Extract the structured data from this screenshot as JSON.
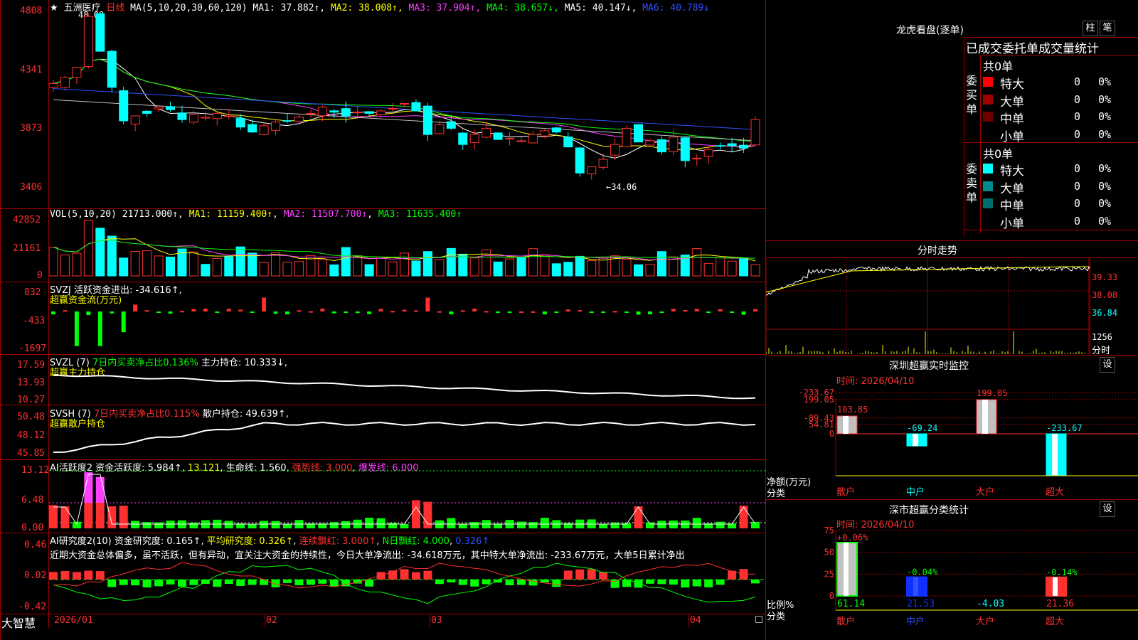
{
  "stock": {
    "star": "★",
    "name": "五洲医疗",
    "period": "日线",
    "ma_def": "MA(5,10,20,30,60,120)"
  },
  "ma_row": [
    {
      "t": "MA1: 37.882↑",
      "c": "#ffffff"
    },
    {
      "t": "MA2: 38.008↑",
      "c": "#ffff00"
    },
    {
      "t": "MA3: 37.904↑",
      "c": "#ff40ff"
    },
    {
      "t": "MA4: 38.657↓",
      "c": "#00ff00"
    },
    {
      "t": "MA5: 40.147↓",
      "c": "#ffffff"
    },
    {
      "t": "MA6: 40.789↓",
      "c": "#3050ff"
    }
  ],
  "price_axis": [
    "4808",
    "4341",
    "3873",
    "3406"
  ],
  "price_high": "48.08",
  "price_low": "←34.06",
  "vol": {
    "def": "VOL(5,10,20)",
    "val": "21713.000↑",
    "ma1": "MA1: 11159.400↑",
    "ma2": "MA2: 11507.700↑",
    "ma3": "MA3: 11635.400↑",
    "axis": [
      "42852",
      "21161",
      "0"
    ]
  },
  "svzj": {
    "title": "SVZJ  活跃资金进出: -34.616↑,",
    "sub": "超赢资金流(万元)",
    "axis": [
      "832",
      "-433",
      "-1697"
    ]
  },
  "svzl": {
    "title": "SVZL (7)",
    "p1": "7日内买卖净占比0.136%",
    "p2": "主力持仓: 10.333↓,",
    "sub": "超赢主力持仓",
    "axis": [
      "17.59",
      "13.93",
      "10.27"
    ]
  },
  "svsh": {
    "title": "SVSH (7)",
    "p1": "7日内买卖净占比0.115%",
    "p2": "散户持仓: 49.639↑,",
    "sub": "超赢散户持仓",
    "axis": [
      "50.48",
      "48.12",
      "45.85"
    ]
  },
  "ai1": {
    "title": "AI活跃度2",
    "p1": "资金活跃度: 5.984↑",
    "p2": "13.121",
    "p3": "生命线: 1.560",
    "p4": "强势线: 3.000",
    "p5": "爆发线: 6.000",
    "axis": [
      "13.12",
      "6.48",
      "0.00"
    ]
  },
  "ai2": {
    "title": "AI研究度2(10)",
    "p1": "资金研究度: 0.165↑",
    "p2": "平均研究度: 0.326↑",
    "p3": "连续飘红: 3.000↑",
    "p4": "N日飘红: 4.000",
    "p5": "0.326↑",
    "axis": [
      "0.46",
      "0.02",
      "-0.42"
    ],
    "comment": "近期大资金总体偏多，虽不活跃，但有异动，宜关注大资金的持续性，今日大单净流出: -34.618万元，其中特大单净流出: -233.67万元，大单5日累计净出"
  },
  "date_axis": [
    "2026/01",
    "02",
    "03",
    "04"
  ],
  "brand": "大智慧",
  "lhb": {
    "title": "龙虎看盘(逐单)",
    "btn1": "柱",
    "btn2": "笔",
    "header": "已成交委托单成交量统计",
    "buy": {
      "label": "委买单",
      "count": "共0单",
      "rows": [
        {
          "name": "特大",
          "v": "0",
          "p": "0%",
          "c": "#ff0000"
        },
        {
          "name": "大单",
          "v": "0",
          "p": "0%",
          "c": "#a00000"
        },
        {
          "name": "中单",
          "v": "0",
          "p": "0%",
          "c": "#700000"
        },
        {
          "name": "小单",
          "v": "0",
          "p": "0%",
          "c": "#000000"
        }
      ]
    },
    "sell": {
      "label": "委卖单",
      "count": "共0单",
      "rows": [
        {
          "name": "特大",
          "v": "0",
          "p": "0%",
          "c": "#00ffff"
        },
        {
          "name": "大单",
          "v": "0",
          "p": "0%",
          "c": "#008c8c"
        },
        {
          "name": "中单",
          "v": "0",
          "p": "0%",
          "c": "#006e6e"
        },
        {
          "name": "小单",
          "v": "0",
          "p": "0%",
          "c": "#000000"
        }
      ]
    }
  },
  "fenshi": {
    "title": "分时走势",
    "axis": [
      "39.33",
      "38.08",
      "36.84"
    ],
    "vol": "1256",
    "vol_lbl": "分时"
  },
  "monitor": {
    "title": "深圳超赢实时监控",
    "btn": "设",
    "time": "时间: 2026/04/10",
    "unit": "净额(万元)",
    "cat_lbl": "分类",
    "axis": [
      "199.05",
      "54.81",
      "0",
      "-89.43",
      "-233.67"
    ],
    "chart_data": {
      "type": "bar",
      "categories": [
        "散户",
        "中户",
        "大户",
        "超大"
      ],
      "values": [
        103.85,
        -69.24,
        199.05,
        -233.67
      ],
      "labels": [
        "103.85",
        "-69.24",
        "199.05",
        "-233.67"
      ],
      "ylim": [
        -233.67,
        199.05
      ]
    }
  },
  "classify": {
    "title": "深市超赢分类统计",
    "btn": "设",
    "time": "时间: 2026/04/10",
    "unit": "比例%",
    "cat_lbl": "分类",
    "axis": [
      "75",
      "50",
      "25",
      "0"
    ],
    "chart_data": {
      "type": "bar",
      "categories": [
        "散户",
        "中户",
        "大户",
        "超大"
      ],
      "values": [
        61.14,
        21.53,
        -4.03,
        21.36
      ],
      "top_labels": [
        "+0.06%",
        "-0.04%",
        "",
        "-0.14%"
      ],
      "bottom_labels": [
        "61.14",
        "21.53",
        "-4.03",
        "21.36"
      ],
      "ylim": [
        0,
        75
      ]
    }
  }
}
